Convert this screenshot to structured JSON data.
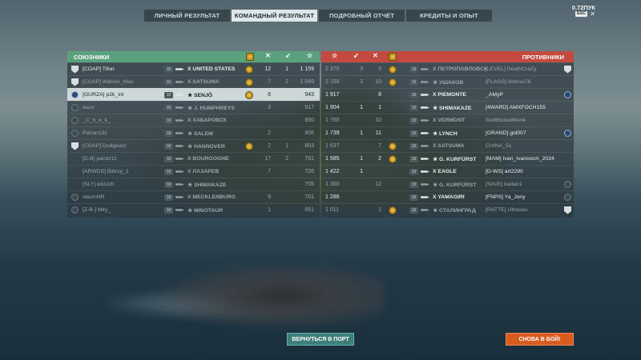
{
  "tabs": [
    {
      "label": "ЛИЧНЫЙ РЕЗУЛЬТАТ",
      "active": false
    },
    {
      "label": "КОМАНДНЫЙ РЕЗУЛЬТАТ",
      "active": true
    },
    {
      "label": "ПОДРОБНЫЙ ОТЧЁТ",
      "active": false
    },
    {
      "label": "КРЕДИТЫ И ОПЫТ",
      "active": false
    }
  ],
  "top_right": {
    "ping": "0.72ПУК",
    "esc": "ESC",
    "close": "✕"
  },
  "allies": {
    "title": "СОЮЗНИКИ",
    "header_icons": [
      "medal-icon",
      "frags-icon",
      "planes-icon",
      "star-icon"
    ],
    "rows": [
      {
        "player": "[COAP] Tifon",
        "tier": "10",
        "ship": "UNITED STATES",
        "n1": "12",
        "n2": "1",
        "n3": "1 159",
        "badge": "shield",
        "medal": true,
        "dim": false,
        "hl": false
      },
      {
        "player": "[COAP] Warrior_Max",
        "tier": "10",
        "ship": "SATSUMA",
        "n1": "7",
        "n2": "2",
        "n3": "1 049",
        "badge": "shield",
        "medal": true,
        "dim": true,
        "hl": false
      },
      {
        "player": "[GURZA] p2k_int",
        "tier": "10",
        "ship": "SENJŌ",
        "n1": "6",
        "n2": "",
        "n3": "943",
        "badge": "clan",
        "medal": true,
        "dim": false,
        "hl": true
      },
      {
        "player": "asuv",
        "tier": "10",
        "ship": "J. HUMPHREYS",
        "n1": "3",
        "n2": "",
        "n3": "917",
        "badge": "dark",
        "medal": false,
        "dim": true,
        "hl": false
      },
      {
        "player": "_C_h_e_k_",
        "tier": "10",
        "ship": "ХАБАРОВСК",
        "n1": "",
        "n2": "",
        "n3": "850",
        "badge": "dark",
        "medal": false,
        "dim": true,
        "hl": false
      },
      {
        "player": "Pahan13z",
        "tier": "10",
        "ship": "SALEM",
        "n1": "2",
        "n2": "",
        "n3": "806",
        "badge": "dark",
        "medal": false,
        "dim": true,
        "hl": false
      },
      {
        "player": "[COAP] Dodgeast",
        "tier": "10",
        "ship": "HANNOVER",
        "n1": "2",
        "n2": "1",
        "n3": "803",
        "badge": "shield",
        "medal": true,
        "dim": true,
        "hl": false
      },
      {
        "player": "[D-B] panzir11",
        "tier": "10",
        "ship": "BOURGOGNE",
        "n1": "17",
        "n2": "2",
        "n3": "791",
        "badge": "none",
        "medal": false,
        "dim": true,
        "hl": false
      },
      {
        "player": "[ARWDS] Bittroy_1",
        "tier": "10",
        "ship": "ЛАЗАРЕВ",
        "n1": "7",
        "n2": "",
        "n3": "726",
        "badge": "none",
        "medal": false,
        "dim": true,
        "hl": false
      },
      {
        "player": "[SLY] edzzzh",
        "tier": "10",
        "ship": "SHIMAKAZE",
        "n1": "",
        "n2": "",
        "n3": "705",
        "badge": "none",
        "medal": false,
        "dim": true,
        "hl": false
      },
      {
        "player": "returnNR",
        "tier": "10",
        "ship": "MECKLENBURG",
        "n1": "9",
        "n2": "",
        "n3": "701",
        "badge": "dark",
        "medal": false,
        "dim": true,
        "hl": false
      },
      {
        "player": "[Z-B-] Mity_",
        "tier": "10",
        "ship": "MINOTAUR",
        "n1": "1",
        "n2": "",
        "n3": "651",
        "badge": "dark",
        "medal": false,
        "dim": true,
        "hl": false
      }
    ]
  },
  "enemies": {
    "title": "ПРОТИВНИКИ",
    "header_icons": [
      "star-icon",
      "planes-icon",
      "frags-icon",
      "medal-icon"
    ],
    "rows": [
      {
        "n3": "2 370",
        "n2": "3",
        "n1": "3",
        "tier": "10",
        "ship": "ПЕТРОПАВЛОВСК",
        "player": "[LEVEL] DeathCraZy",
        "medal": true,
        "badge": "shield",
        "dim": true
      },
      {
        "n3": "2 159",
        "n2": "3",
        "n1": "10",
        "tier": "10",
        "ship": "УШАКОВ",
        "player": "[FLAGS] dvbrou78",
        "medal": true,
        "badge": "none",
        "dim": true
      },
      {
        "n3": "1 917",
        "n2": "",
        "n1": "8",
        "tier": "10",
        "ship": "PIEMONTE",
        "player": "_AMyP",
        "medal": false,
        "badge": "clan",
        "dim": false
      },
      {
        "n3": "1 904",
        "n2": "1",
        "n1": "1",
        "tier": "10",
        "ship": "SHIMAKAZE",
        "player": "[4WARD] AMXFOCH155",
        "medal": false,
        "badge": "none",
        "dim": false
      },
      {
        "n3": "1 760",
        "n2": "",
        "n1": "10",
        "tier": "10",
        "ship": "VERMONT",
        "player": "SwiftfootedMonk",
        "medal": false,
        "badge": "none",
        "dim": true
      },
      {
        "n3": "1 739",
        "n2": "1",
        "n1": "11",
        "tier": "10",
        "ship": "LYNCH",
        "player": "[GRAND] gol007",
        "medal": false,
        "badge": "clan",
        "dim": false
      },
      {
        "n3": "1 637",
        "n2": "",
        "n1": "7",
        "tier": "10",
        "ship": "SATSUMA",
        "player": "CHINA_51",
        "medal": true,
        "badge": "none",
        "dim": true
      },
      {
        "n3": "1 585",
        "n2": "1",
        "n1": "2",
        "tier": "10",
        "ship": "G. KURFÜRST",
        "player": "[MAM] Ivan_Ivanovich_2024",
        "medal": true,
        "badge": "none",
        "dim": false
      },
      {
        "n3": "1 422",
        "n2": "1",
        "n1": "",
        "tier": "10",
        "ship": "EAGLE",
        "player": "[D-WS] art2290",
        "medal": false,
        "badge": "none",
        "dim": false
      },
      {
        "n3": "1 360",
        "n2": "",
        "n1": "12",
        "tier": "10",
        "ship": "G. KURFÜRST",
        "player": "[SAVE] kadan1",
        "medal": false,
        "badge": "dark",
        "dim": true
      },
      {
        "n3": "1 286",
        "n2": "",
        "n1": "",
        "tier": "10",
        "ship": "YAMAGIRI",
        "player": "[FNPS] Ya_Jony",
        "medal": false,
        "badge": "dark",
        "dim": false
      },
      {
        "n3": "1 011",
        "n2": "",
        "n1": "1",
        "tier": "10",
        "ship": "СТАЛИНГРАД",
        "player": "[RATTE] Ultrases",
        "medal": true,
        "badge": "shield",
        "dim": true
      }
    ]
  },
  "buttons": {
    "port": "ВЕРНУТЬСЯ В ПОРТ",
    "fight": "СНОВА В БОЙ!"
  }
}
